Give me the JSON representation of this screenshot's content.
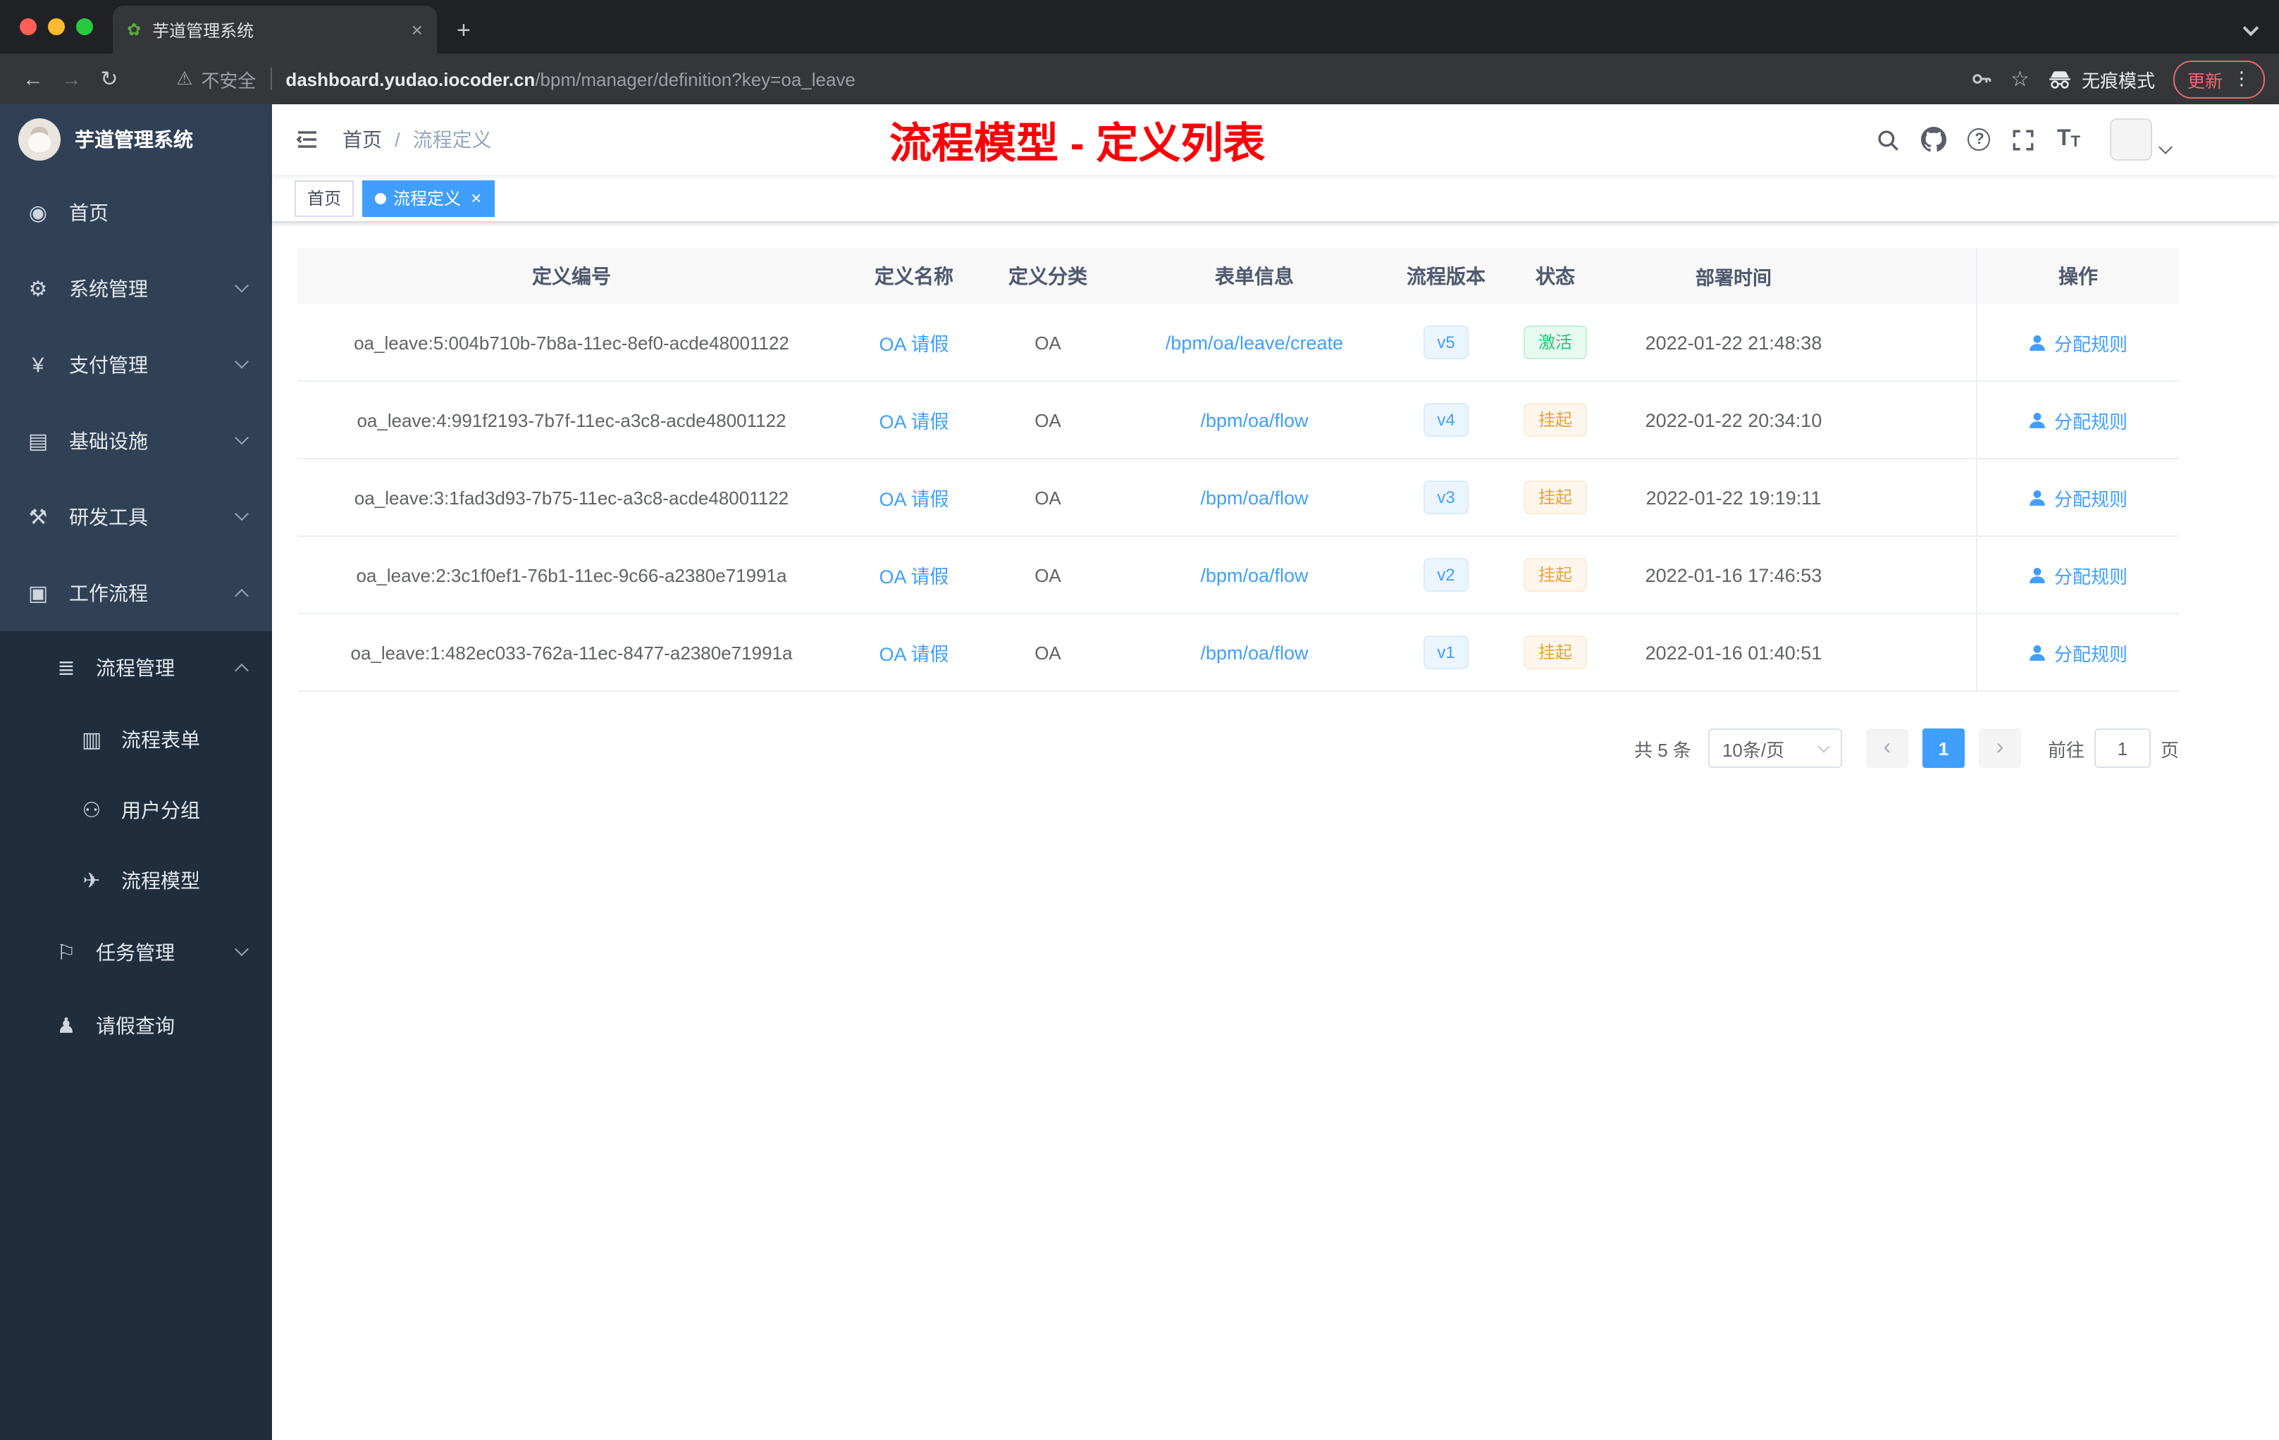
{
  "colors": {
    "accent": "#409eff",
    "success": "#1cc77a",
    "warning": "#e6a23c",
    "annotation_red": "#fb0007",
    "sidebar": "#304156",
    "sidebar_submenu": "#1f2d3d"
  },
  "icons": {
    "favicon": "✿",
    "back": "←",
    "forward": "→",
    "reload": "↻",
    "warning": "⚠",
    "star": "☆",
    "dots": "⋮",
    "close": "×",
    "plus": "+",
    "question": "?",
    "font_big": "T",
    "font_small": "T",
    "home": "◉",
    "gear": "⚙",
    "yen": "¥",
    "infra": "▤",
    "tool": "⚒",
    "work": "▣",
    "list": "≣",
    "form": "▥",
    "group": "⚇",
    "send": "✈",
    "task": "⚐",
    "person": "♟"
  },
  "browser": {
    "tab_title": "芋道管理系统",
    "not_secure": "不安全",
    "url_domain": "dashboard.yudao.iocoder.cn",
    "url_path": "/bpm/manager/definition?key=oa_leave",
    "incognito_label": "无痕模式",
    "update_label": "更新"
  },
  "sidebar": {
    "logo_title": "芋道管理系统",
    "items": [
      {
        "label": "首页"
      },
      {
        "label": "系统管理"
      },
      {
        "label": "支付管理"
      },
      {
        "label": "基础设施"
      },
      {
        "label": "研发工具"
      },
      {
        "label": "工作流程"
      },
      {
        "label": "流程管理"
      },
      {
        "label": "流程表单"
      },
      {
        "label": "用户分组"
      },
      {
        "label": "流程模型"
      },
      {
        "label": "任务管理"
      },
      {
        "label": "请假查询"
      }
    ]
  },
  "header": {
    "breadcrumb_home": "首页",
    "breadcrumb_separator": "/",
    "breadcrumb_current": "流程定义",
    "annotation": "流程模型 - 定义列表"
  },
  "tags": {
    "home": "首页",
    "active": "流程定义"
  },
  "table": {
    "columns": [
      "定义编号",
      "定义名称",
      "定义分类",
      "表单信息",
      "流程版本",
      "状态",
      "部署时间",
      "操作"
    ],
    "rows": [
      {
        "id": "oa_leave:5:004b710b-7b8a-11ec-8ef0-acde48001122",
        "name": "OA 请假",
        "category": "OA",
        "form": "/bpm/oa/leave/create",
        "version": "v5",
        "status": "激活",
        "time": "2022-01-22 21:48:38",
        "action": "分配规则"
      },
      {
        "id": "oa_leave:4:991f2193-7b7f-11ec-a3c8-acde48001122",
        "name": "OA 请假",
        "category": "OA",
        "form": "/bpm/oa/flow",
        "version": "v4",
        "status": "挂起",
        "time": "2022-01-22 20:34:10",
        "action": "分配规则"
      },
      {
        "id": "oa_leave:3:1fad3d93-7b75-11ec-a3c8-acde48001122",
        "name": "OA 请假",
        "category": "OA",
        "form": "/bpm/oa/flow",
        "version": "v3",
        "status": "挂起",
        "time": "2022-01-22 19:19:11",
        "action": "分配规则"
      },
      {
        "id": "oa_leave:2:3c1f0ef1-76b1-11ec-9c66-a2380e71991a",
        "name": "OA 请假",
        "category": "OA",
        "form": "/bpm/oa/flow",
        "version": "v2",
        "status": "挂起",
        "time": "2022-01-16 17:46:53",
        "action": "分配规则"
      },
      {
        "id": "oa_leave:1:482ec033-762a-11ec-8477-a2380e71991a",
        "name": "OA 请假",
        "category": "OA",
        "form": "/bpm/oa/flow",
        "version": "v1",
        "status": "挂起",
        "time": "2022-01-16 01:40:51",
        "action": "分配规则"
      }
    ]
  },
  "pagination": {
    "total": "共 5 条",
    "page_size": "10条/页",
    "prev": "‹",
    "page": "1",
    "next": "›",
    "goto_prefix": "前往",
    "goto_value": "1",
    "goto_suffix": "页"
  }
}
